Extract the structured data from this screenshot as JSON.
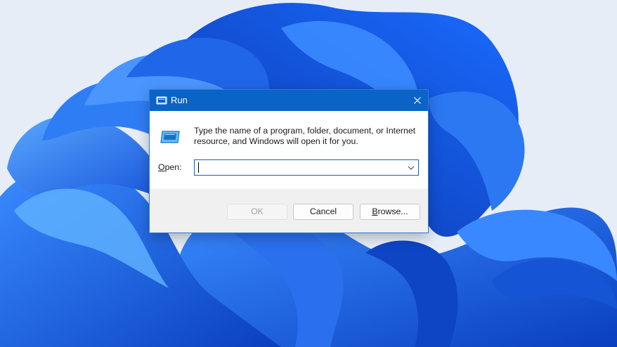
{
  "dialog": {
    "title": "Run",
    "description": "Type the name of a program, folder, document, or Internet\nresource, and Windows will open it for you.",
    "open_label_access": "O",
    "open_label_rest": "pen:",
    "open_value": "",
    "ok_label": "OK",
    "cancel_label": "Cancel",
    "browse_label_access": "B",
    "browse_label_rest": "rowse..."
  },
  "colors": {
    "titlebar": "#0a64c8",
    "wallpaper_blue": "#1a5fe0",
    "wallpaper_background": "#e6edf6"
  },
  "icons": {
    "title": "run-icon",
    "close": "close-icon",
    "main": "run-icon",
    "dropdown": "chevron-down-icon"
  }
}
